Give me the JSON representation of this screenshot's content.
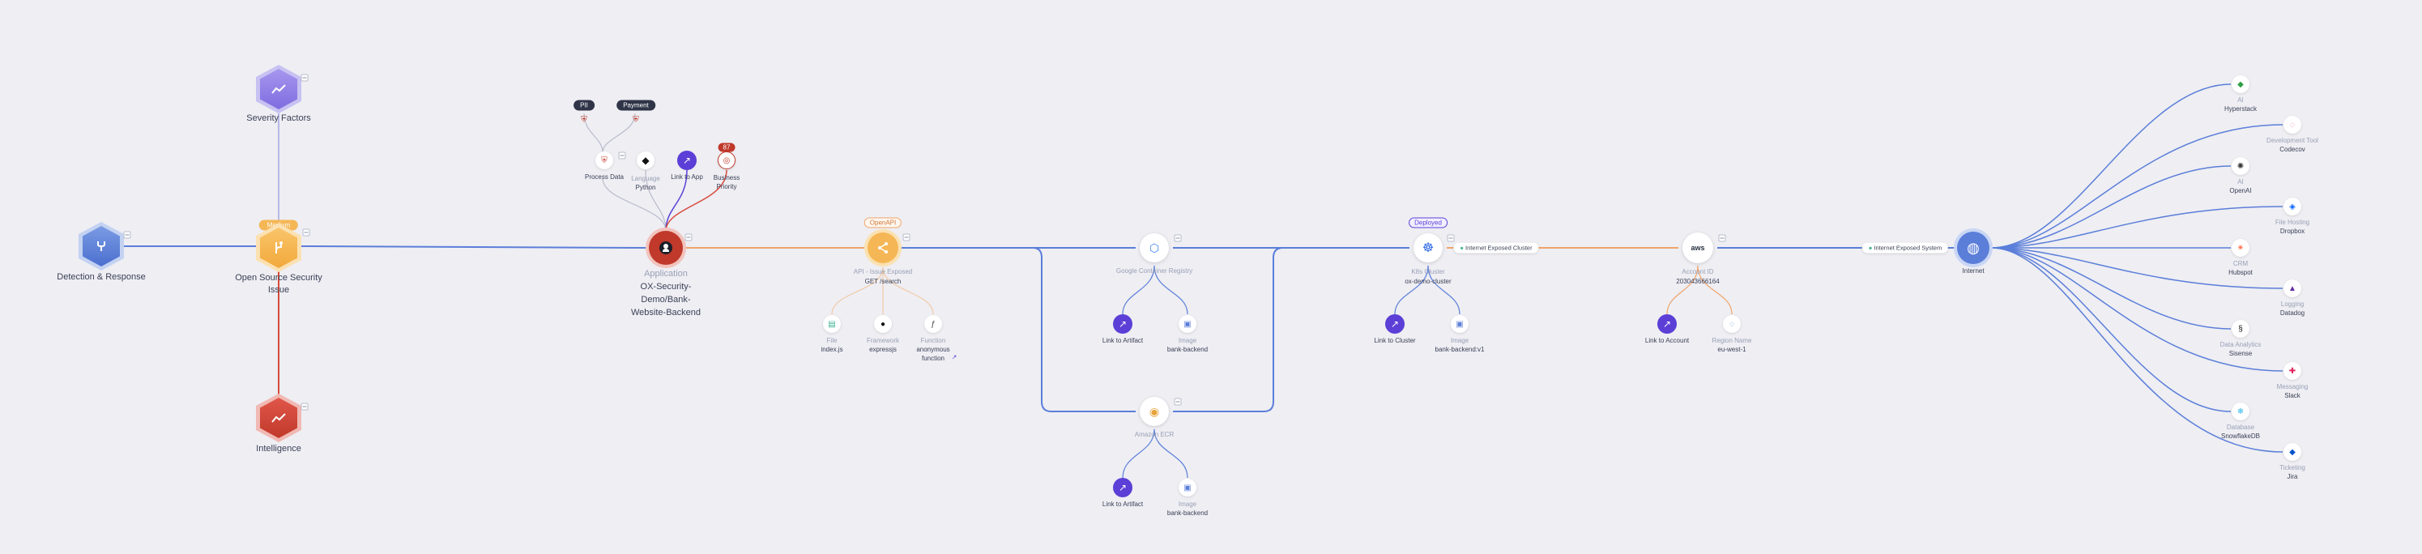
{
  "colors": {
    "background": "#eeeef3",
    "blue_edge": "#5b7ed9",
    "orange_edge": "#f0a46a",
    "red_edge": "#d84a3a",
    "purple": "#5b3fd6",
    "grey_edge": "#b9bccb"
  },
  "left": {
    "severity": {
      "label": "Severity Factors",
      "icon": "chart-line-icon"
    },
    "detection": {
      "label": "Detection & Response",
      "icon": "fork-icon"
    },
    "oss": {
      "badge": "Medium",
      "label_1": "Open Source Security",
      "label_2": "Issue",
      "icon": "branch-icon"
    },
    "intelligence": {
      "label": "Intelligence",
      "icon": "chart-line-icon"
    }
  },
  "app": {
    "tag_pii": "PII",
    "tag_payment": "Payment",
    "process_data": "Process Data",
    "language_sub": "Language",
    "language": "Python",
    "link_to_app": "Link to App",
    "priority_badge": "87",
    "priority_1": "Business",
    "priority_2": "Priority",
    "type": "Application",
    "name_1": "OX-Security-",
    "name_2": "Demo/Bank-",
    "name_3": "Website-Backend"
  },
  "api": {
    "badge": "OpenAPI",
    "type": "API - Issue Exposed",
    "name": "GET /search",
    "file_sub": "File",
    "file": "index.js",
    "framework_sub": "Framework",
    "framework": "expressjs",
    "function_sub": "Function",
    "function_1": "anonymous",
    "function_2": "function"
  },
  "gcr": {
    "type": "Google Container Registry",
    "link": "Link to Artifact",
    "image_sub": "Image",
    "image": "bank-backend"
  },
  "ecr": {
    "type": "Amazon ECR",
    "link": "Link to Artifact",
    "image_sub": "Image",
    "image": "bank-backend"
  },
  "k8s": {
    "badge": "Deployed",
    "type": "K8s Cluster",
    "name": "ox-demo-cluster",
    "link": "Link to Cluster",
    "image_sub": "Image",
    "image": "bank-backend:v1"
  },
  "exposed_1": "Internet Exposed Cluster",
  "aws": {
    "logo": "aws",
    "type": "Account ID",
    "name": "203043666164",
    "link": "Link to Account",
    "region_sub": "Region Name",
    "region": "eu-west-1"
  },
  "exposed_2": "Internet Exposed System",
  "internet": {
    "label": "Internet"
  },
  "services": [
    {
      "sub": "AI",
      "name": "Hyperstack"
    },
    {
      "sub": "Development Tool",
      "name": "Codecov"
    },
    {
      "sub": "AI",
      "name": "OpenAI"
    },
    {
      "sub": "File Hosting",
      "name": "Dropbox"
    },
    {
      "sub": "CRM",
      "name": "Hubspot"
    },
    {
      "sub": "Logging",
      "name": "Datadog"
    },
    {
      "sub": "Data Analytics",
      "name": "Sisense"
    },
    {
      "sub": "Messaging",
      "name": "Slack"
    },
    {
      "sub": "Database",
      "name": "SnowflakeDB"
    },
    {
      "sub": "Ticketing",
      "name": "Jira"
    }
  ]
}
